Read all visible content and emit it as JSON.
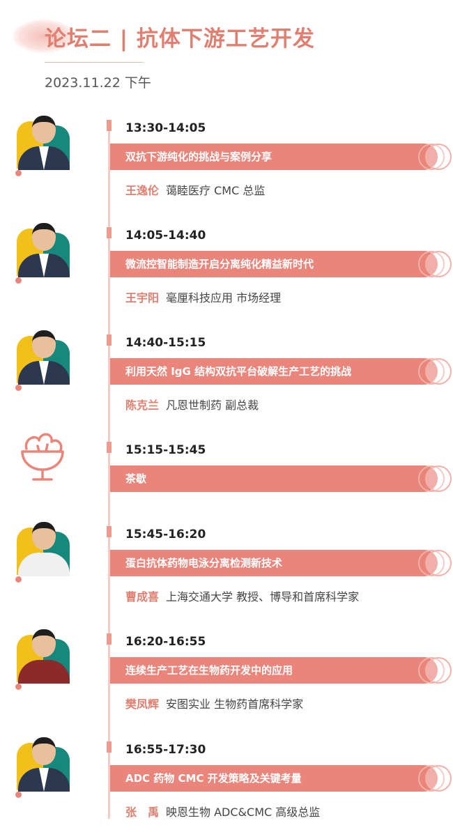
{
  "header": {
    "title": "论坛二 | 抗体下游工艺开发",
    "date": "2023.11.22 下午"
  },
  "colors": {
    "accent": "#e9857a",
    "title": "#e07f70",
    "timeline": "#f6cbc4",
    "avatar_yellow": "#f2c01b",
    "avatar_teal": "#16887c"
  },
  "sessions": [
    {
      "time": "13:30-14:05",
      "topic": "双抗下游纯化的挑战与案例分享",
      "name": "王逸伦",
      "title": "蔼睦医疗 CMC 总监",
      "icon": "speaker-photo"
    },
    {
      "time": "14:05-14:40",
      "topic": "微流控智能制造开启分离纯化精益新时代",
      "name": "王宇阳",
      "title": "毫厘科技应用 市场经理",
      "icon": "speaker-photo"
    },
    {
      "time": "14:40-15:15",
      "topic": "利用天然 IgG 结构双抗平台破解生产工艺的挑战",
      "name": "陈克兰",
      "title": "凡恩世制药 副总裁",
      "icon": "speaker-photo"
    },
    {
      "time": "15:15-15:45",
      "topic": "茶歇",
      "name": "",
      "title": "",
      "icon": "dessert-cup-icon"
    },
    {
      "time": "15:45-16:20",
      "topic": "蛋白抗体药物电泳分离检测新技术",
      "name": "曹成喜",
      "title": "上海交通大学 教授、博导和首席科学家",
      "icon": "speaker-photo"
    },
    {
      "time": "16:20-16:55",
      "topic": "连续生产工艺在生物药开发中的应用",
      "name": "樊凤辉",
      "title": "安图实业 生物药首席科学家",
      "icon": "speaker-photo"
    },
    {
      "time": "16:55-17:30",
      "topic": "ADC 药物 CMC 开发策略及关键考量",
      "name": "张　禹",
      "title": "映恩生物 ADC&CMC 高级总监",
      "icon": "speaker-photo"
    }
  ]
}
